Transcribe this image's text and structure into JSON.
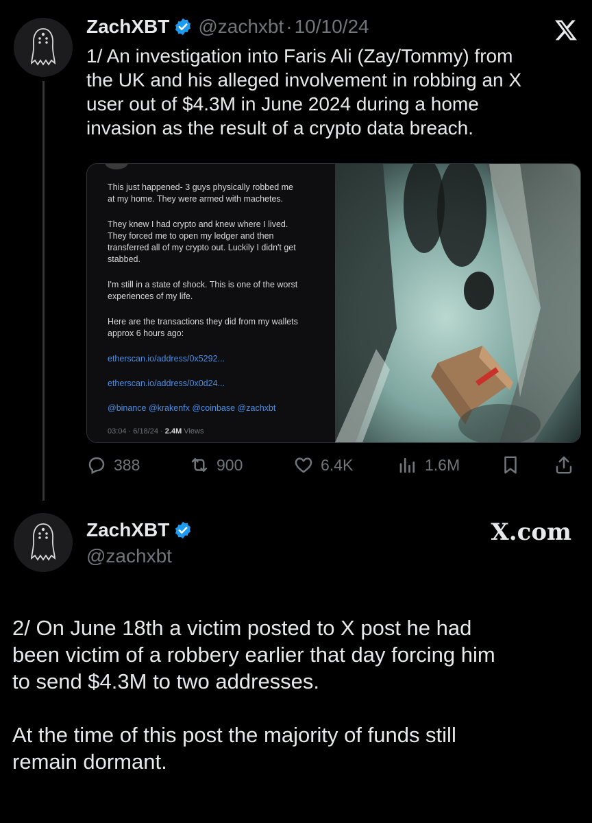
{
  "tweet1": {
    "name": "ZachXBT",
    "handle": "@zachxbt",
    "separator": "·",
    "date": "10/10/24",
    "lines": [
      "1/ An investigation into Faris Ali (Zay/Tommy) from",
      "the UK and his alleged involvement in robbing an X",
      "user out of $4.3M in June 2024 during a home",
      "invasion as the result of a crypto data breach."
    ],
    "embedded": {
      "p1": [
        "This just happened- 3 guys physically robbed me",
        "at my home. They were armed with machetes."
      ],
      "p2": [
        "They knew I had crypto and knew where I lived.",
        "They forced me to open my ledger and then",
        "transferred all of my crypto out. Luckily I didn't get",
        "stabbed."
      ],
      "p3": [
        "I'm still in a state of shock. This is one of the worst",
        "experiences of my life."
      ],
      "p4": [
        "Here are the transactions they did from my wallets",
        "approx 6 hours ago:"
      ],
      "link1": "etherscan.io/address/0x5292...",
      "link2": "etherscan.io/address/0x0d24...",
      "mentions": "@binance @krakenfx @coinbase @zachxbt",
      "meta_time": "03:04 · 6/18/24 · ",
      "meta_views_num": "2.4M",
      "meta_views_word": " Views"
    },
    "actions": {
      "replies": "388",
      "reposts": "900",
      "likes": "6.4K",
      "views": "1.6M"
    }
  },
  "tweet2": {
    "name": "ZachXBT",
    "handle": "@zachxbt",
    "site": "X.com",
    "lines": [
      "2/ On June 18th a victim posted to X post he had",
      "been victim of a robbery earlier that day forcing him",
      "to send $4.3M to two addresses.",
      "",
      "At the time of this post the majority of funds still",
      "remain dormant."
    ]
  },
  "colors": {
    "background": "#000000",
    "text": "#e7e9ea",
    "muted": "#71767b",
    "verified": "#1d9bf0",
    "link": "#4a8fe7"
  }
}
